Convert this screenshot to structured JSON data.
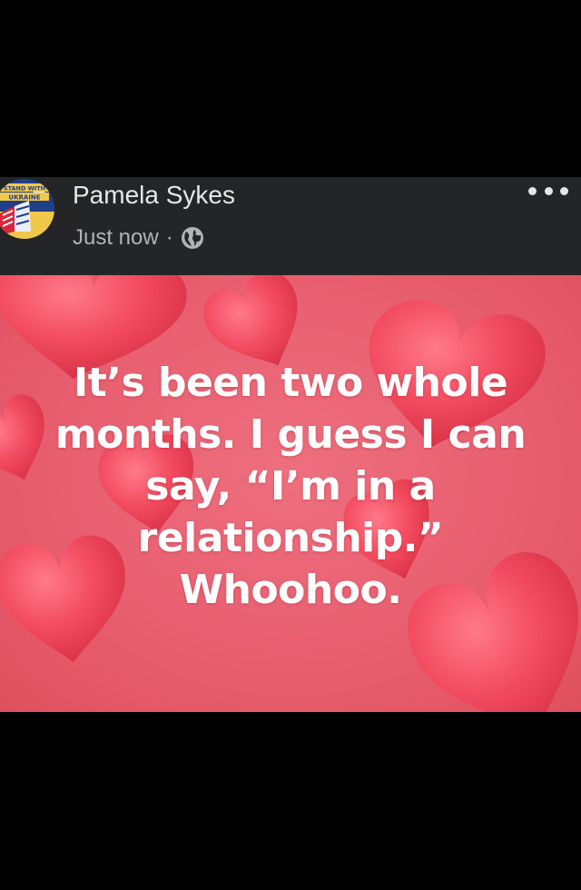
{
  "post": {
    "author": {
      "name": "Pamela Sykes"
    },
    "avatar_badge": {
      "line1": "STAND WITH",
      "line2": "UKRAINE"
    },
    "timestamp": "Just now",
    "separator": "·",
    "audience_icon": "globe-icon",
    "more_icon": "more-options-icon",
    "text_lines": [
      "It’s been two whole",
      "months. I guess I can",
      "say, “I’m in a",
      "relationship.”",
      "Whoohoo."
    ],
    "background_theme": "hearts",
    "colors": {
      "header_bg": "#242526",
      "name": "#e4e6eb",
      "meta": "#b0b3b8",
      "background": "#e8606f",
      "heart": "#f24a5f",
      "text": "#ffffff"
    }
  }
}
